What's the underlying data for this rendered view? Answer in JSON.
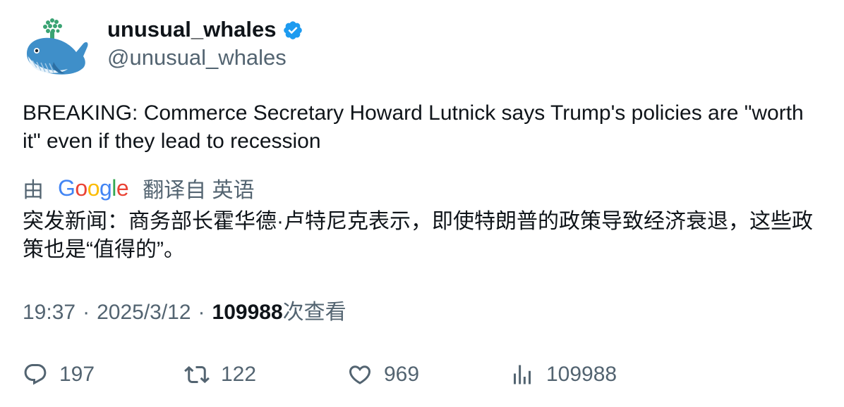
{
  "author": {
    "display_name": "unusual_whales",
    "handle": "@unusual_whales",
    "avatar_icon": "whale-logo",
    "verified_icon": "verified-badge-icon",
    "verified_color": "#1d9bf0"
  },
  "tweet": {
    "text": "BREAKING: Commerce Secretary Howard Lutnick says Trump's policies are \"worth it\" even if they lead to recession"
  },
  "translation": {
    "prefix": "由",
    "google_logo": {
      "letters": [
        "G",
        "o",
        "o",
        "g",
        "l",
        "e"
      ]
    },
    "suffix": "翻译自 英语",
    "text": "突发新闻：商务部长霍华德·卢特尼克表示，即使特朗普的政策导致经济衰退，这些政策也是“值得的”。"
  },
  "meta": {
    "time": "19:37",
    "separator": "·",
    "date": "2025/3/12",
    "views_count": "109988",
    "views_label": "次查看"
  },
  "actions": {
    "reply_count": "197",
    "retweet_count": "122",
    "like_count": "969",
    "views_count": "109988"
  },
  "colors": {
    "text_primary": "#0f1419",
    "text_secondary": "#536471",
    "google_blue": "#4285F4",
    "google_red": "#EA4335",
    "google_yellow": "#FBBC05",
    "google_green": "#34A853"
  }
}
